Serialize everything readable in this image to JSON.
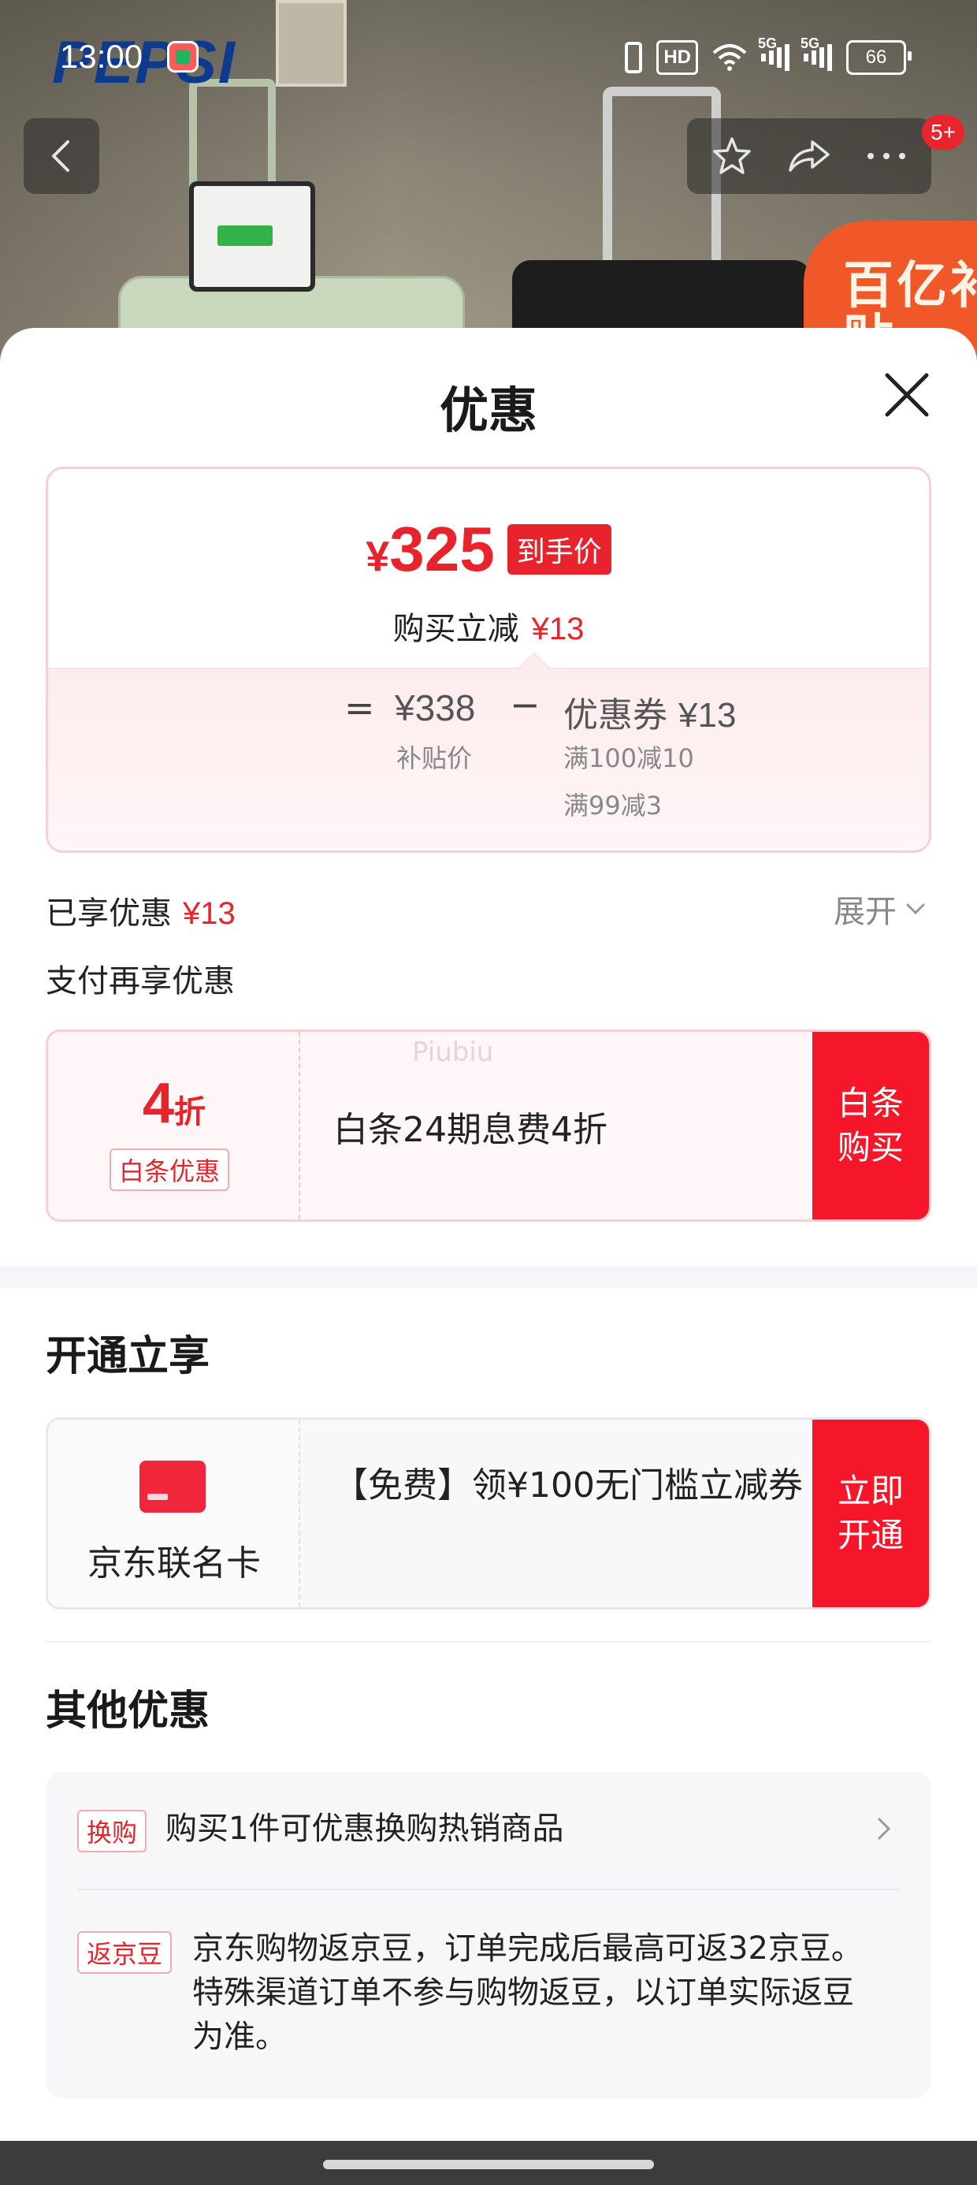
{
  "status_bar": {
    "time": "13:00",
    "hd_label": "HD",
    "signal_1": "5G",
    "signal_2": "5G",
    "battery": "66"
  },
  "background": {
    "brand_logo": "PEPSI",
    "promo_badge": "百亿补贴"
  },
  "nav": {
    "message_badge": "5+"
  },
  "sheet": {
    "title": "优惠",
    "price_card": {
      "final_currency": "¥",
      "final_price": "325",
      "final_tag": "到手价",
      "instant_cut_label": "购买立减",
      "instant_cut_value": "¥13",
      "equals": "=",
      "subsidy_price": "¥338",
      "subsidy_label": "补贴价",
      "minus": "−",
      "coupon_label": "优惠券",
      "coupon_value": "¥13",
      "rule_1": "满100减10",
      "rule_2": "满99减3"
    },
    "enjoyed_label": "已享优惠",
    "enjoyed_value": "¥13",
    "expand_label": "展开",
    "pay_more_label": "支付再享优惠",
    "baitiao": {
      "discount_number": "4",
      "discount_unit": "折",
      "tag": "白条优惠",
      "description": "白条24期息费4折",
      "watermark": "Piubiu",
      "cta": "白条购买"
    },
    "open_section_title": "开通立享",
    "jd_card": {
      "name": "京东联名卡",
      "description": "【免费】领¥100无门槛立减券",
      "cta": "立即开通"
    },
    "other_section_title": "其他优惠",
    "other": [
      {
        "tag": "换购",
        "text": "购买1件可优惠换购热销商品"
      },
      {
        "tag": "返京豆",
        "text": "京东购物返京豆，订单完成后最高可返32京豆。特殊渠道订单不参与购物返豆，以订单实际返豆为准。"
      }
    ]
  },
  "colors": {
    "accent_red": "#e8232c",
    "cta_red": "#f5162a",
    "card_pink_border": "#f8cfd3"
  },
  "icons": [
    "back-arrow-icon",
    "star-icon",
    "share-icon",
    "more-icon",
    "close-icon",
    "chevron-down-icon",
    "chevron-right-icon",
    "credit-card-icon",
    "wifi-icon",
    "vibrate-icon",
    "battery-icon"
  ]
}
